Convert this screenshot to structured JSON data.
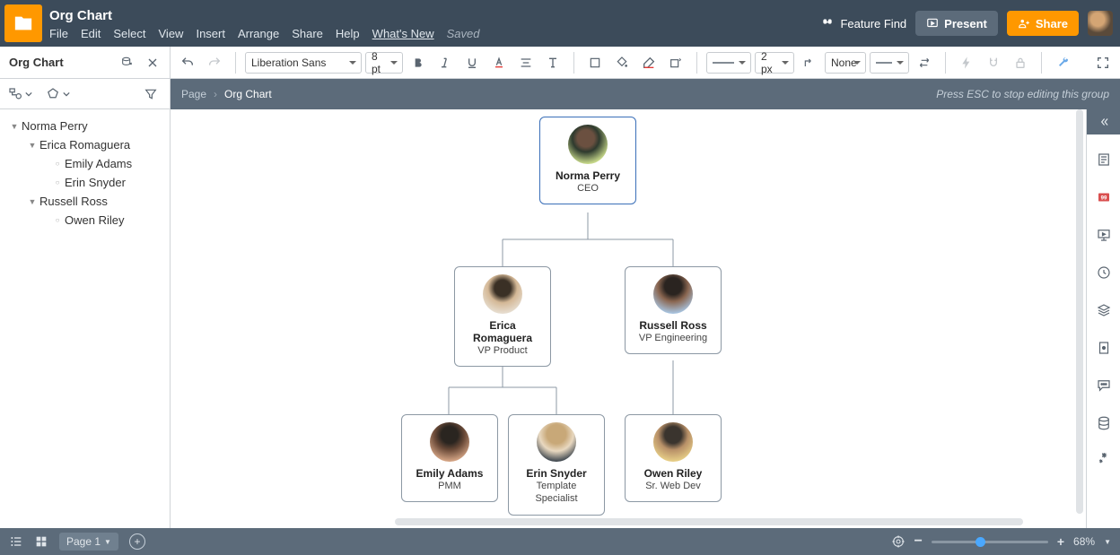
{
  "doc": {
    "title": "Org Chart",
    "saved_label": "Saved"
  },
  "menu": {
    "file": "File",
    "edit": "Edit",
    "select": "Select",
    "view": "View",
    "insert": "Insert",
    "arrange": "Arrange",
    "share": "Share",
    "help": "Help",
    "whatsnew": "What's New"
  },
  "topbar": {
    "feature_find": "Feature Find",
    "present": "Present",
    "share": "Share"
  },
  "toolbar": {
    "outline_title": "Org Chart",
    "font": "Liberation Sans",
    "font_size": "8 pt",
    "line_px": "2 px",
    "line_end": "None"
  },
  "breadcrumb": {
    "root": "Page",
    "current": "Org Chart",
    "hint": "Press ESC to stop editing this group"
  },
  "tree": {
    "n0": "Norma Perry",
    "n1": "Erica Romaguera",
    "n2": "Emily Adams",
    "n3": "Erin Snyder",
    "n4": "Russell Ross",
    "n5": "Owen Riley"
  },
  "nodes": {
    "ceo": {
      "name": "Norma Perry",
      "role": "CEO"
    },
    "vp1": {
      "name": "Erica Romaguera",
      "role": "VP Product"
    },
    "vp2": {
      "name": "Russell Ross",
      "role": "VP Engineering"
    },
    "emp1": {
      "name": "Emily Adams",
      "role": "PMM"
    },
    "emp2": {
      "name": "Erin Snyder",
      "role": "Template Specialist"
    },
    "emp3": {
      "name": "Owen Riley",
      "role": "Sr. Web Dev"
    }
  },
  "bottom": {
    "page_label": "Page 1",
    "zoom_label": "68%"
  }
}
